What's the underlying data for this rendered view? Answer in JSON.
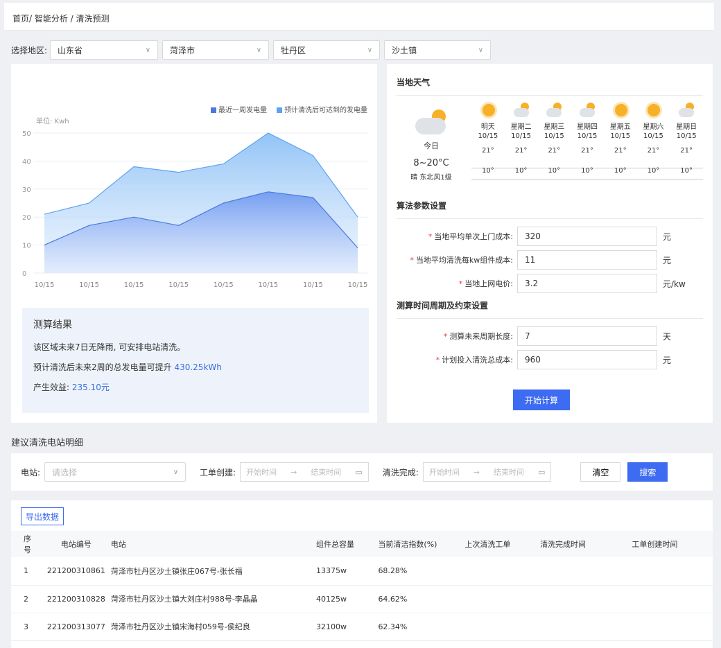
{
  "breadcrumb": "首页/ 智能分析 / 清洗预测",
  "region": {
    "label": "选择地区:",
    "province": "山东省",
    "city": "菏泽市",
    "district": "牡丹区",
    "town": "沙土镇"
  },
  "chart_data": {
    "type": "area",
    "unit_label": "单位: Kwh",
    "categories": [
      "10/15",
      "10/15",
      "10/15",
      "10/15",
      "10/15",
      "10/15",
      "10/15",
      "10/15"
    ],
    "y_ticks": [
      "0",
      "10",
      "20",
      "30",
      "40",
      "50"
    ],
    "ylim": [
      0,
      50
    ],
    "series": [
      {
        "name": "最近一周发电量",
        "color": "#5b8df2",
        "values": [
          10,
          17,
          20,
          17,
          25,
          29,
          27,
          9
        ]
      },
      {
        "name": "预计清洗后可达到的发电量",
        "color": "#8fc1f7",
        "values": [
          21,
          25,
          38,
          36,
          39,
          50,
          42,
          20
        ]
      }
    ]
  },
  "result": {
    "title": "测算结果",
    "line1": "该区域未来7日无降雨, 可安排电站清洗。",
    "line2_prefix": "预计清洗后未来2周的总发电量可提升 ",
    "line2_value": "430.25kWh",
    "line3_prefix": "产生效益: ",
    "line3_value": "235.10元"
  },
  "weather": {
    "title": "当地天气",
    "today": {
      "label": "今日",
      "temp": "8~20°C",
      "desc": "晴 东北风1级"
    },
    "days": [
      {
        "name": "明天",
        "date": "10/15",
        "hi": "21°",
        "lo": "10°",
        "icon": "sun-icon"
      },
      {
        "name": "星期二",
        "date": "10/15",
        "hi": "21°",
        "lo": "10°",
        "icon": "cloud-sun-icon"
      },
      {
        "name": "星期三",
        "date": "10/15",
        "hi": "21°",
        "lo": "10°",
        "icon": "cloud-sun-icon"
      },
      {
        "name": "星期四",
        "date": "10/15",
        "hi": "21°",
        "lo": "10°",
        "icon": "cloud-sun-icon"
      },
      {
        "name": "星期五",
        "date": "10/15",
        "hi": "21°",
        "lo": "10°",
        "icon": "sun-icon"
      },
      {
        "name": "星期六",
        "date": "10/15",
        "hi": "21°",
        "lo": "10°",
        "icon": "sun-icon"
      },
      {
        "name": "星期日",
        "date": "10/15",
        "hi": "21°",
        "lo": "10°",
        "icon": "cloud-sun-icon"
      }
    ]
  },
  "algo": {
    "title": "算法参数设置",
    "fields": [
      {
        "label": "当地平均单次上门成本:",
        "value": "320",
        "suffix": "元"
      },
      {
        "label": "当地平均清洗每kw组件成本:",
        "value": "11",
        "suffix": "元"
      },
      {
        "label": "当地上网电价:",
        "value": "3.2",
        "suffix": "元/kw"
      }
    ]
  },
  "period": {
    "title": "测算时间周期及约束设置",
    "fields": [
      {
        "label": "测算未来周期长度:",
        "value": "7",
        "suffix": "天"
      },
      {
        "label": "计划投入清洗总成本:",
        "value": "960",
        "suffix": "元"
      }
    ],
    "button": "开始计算"
  },
  "detail": {
    "title": "建议清洗电站明细",
    "station_label": "电站:",
    "station_placeholder": "请选择",
    "order_label": "工单创建:",
    "clean_label": "清洗完成:",
    "start_placeholder": "开始时间",
    "end_placeholder": "结束时间",
    "clear": "清空",
    "search": "搜索",
    "export": "导出数据",
    "columns": [
      "序号",
      "电站编号",
      "电站",
      "组件总容量",
      "当前清洁指数(%)",
      "上次清洗工单",
      "清洗完成时间",
      "工单创建时间"
    ],
    "rows": [
      {
        "idx": "1",
        "code": "221200310861",
        "name": "菏泽市牡丹区沙土镇张庄067号-张长福",
        "capacity": "13375w",
        "index": "68.28%"
      },
      {
        "idx": "2",
        "code": "221200310828",
        "name": "菏泽市牡丹区沙土镇大刘庄村988号-李晶晶",
        "capacity": "40125w",
        "index": "64.62%"
      },
      {
        "idx": "3",
        "code": "221200313077",
        "name": "菏泽市牡丹区沙土镇宋海村059号-侯纪良",
        "capacity": "32100w",
        "index": "62.34%"
      }
    ]
  }
}
